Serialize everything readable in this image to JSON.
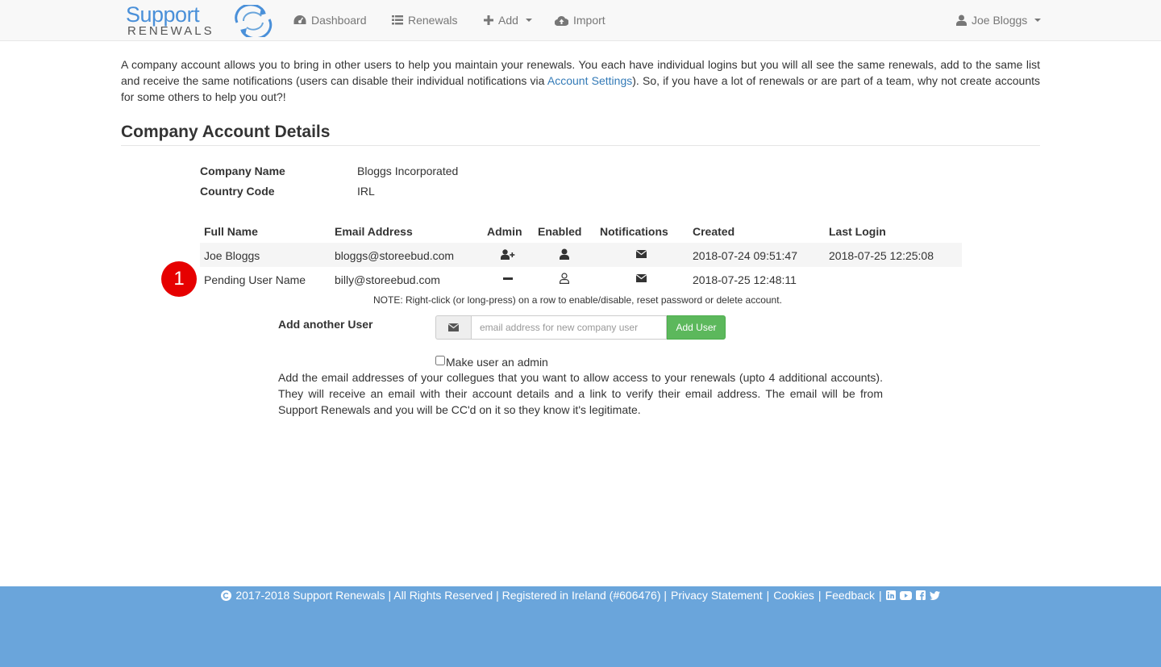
{
  "brand": {
    "line1": "Support",
    "line2": "RENEWALS"
  },
  "nav": {
    "dashboard": "Dashboard",
    "renewals": "Renewals",
    "add": "Add",
    "import": "Import",
    "user": "Joe Bloggs"
  },
  "intro": {
    "before_link": "A company account allows you to bring in other users to help you maintain your renewals. You each have individual logins but you will all see the same renewals, add to the same list and receive the same notifications (users can disable their individual notifications via ",
    "link": "Account Settings",
    "after_link": "). So, if you have a lot of renewals or are part of a team, why not create accounts for some others to help you out?!"
  },
  "section_title": "Company Account Details",
  "company": {
    "name_label": "Company Name",
    "name_value": "Bloggs Incorporated",
    "country_label": "Country Code",
    "country_value": "IRL"
  },
  "table": {
    "headers": [
      "Full Name",
      "Email Address",
      "Admin",
      "Enabled",
      "Notifications",
      "Created",
      "Last Login"
    ],
    "rows": [
      {
        "name": "Joe Bloggs",
        "email": "bloggs@storeebud.com",
        "admin_icon": "user-plus-icon",
        "enabled_icon": "user-solid-icon",
        "notifications_icon": "envelope-icon",
        "created": "2018-07-24 09:51:47",
        "last_login": "2018-07-25 12:25:08"
      },
      {
        "name": "Pending User Name",
        "email": "billy@storeebud.com",
        "admin_icon": "minus-icon",
        "enabled_icon": "user-outline-icon",
        "notifications_icon": "envelope-icon",
        "created": "2018-07-25 12:48:11",
        "last_login": ""
      }
    ]
  },
  "annotation_badge": "1",
  "note": "NOTE: Right-click (or long-press) on a row to enable/disable, reset password or delete account.",
  "add_user": {
    "label": "Add another User",
    "placeholder": "email address for new company user",
    "button": "Add User",
    "admin_checkbox": "Make user an admin",
    "help": "Add the email addresses of your collegues that you want to allow access to your renewals (upto 4 additional accounts). They will receive an email with their account details and a link to verify their email address. The email will be from Support Renewals and you will be CC'd on it so they know it's legitimate."
  },
  "footer": {
    "copyright": "2017-2018 Support Renewals | All Rights Reserved | Registered in Ireland (#606476) |",
    "privacy": "Privacy Statement",
    "cookies": "Cookies",
    "feedback": "Feedback",
    "sep": "|"
  },
  "colors": {
    "accent": "#337ab7",
    "success": "#5cb85c",
    "footer": "#6aa5db",
    "badge": "#e60000"
  }
}
